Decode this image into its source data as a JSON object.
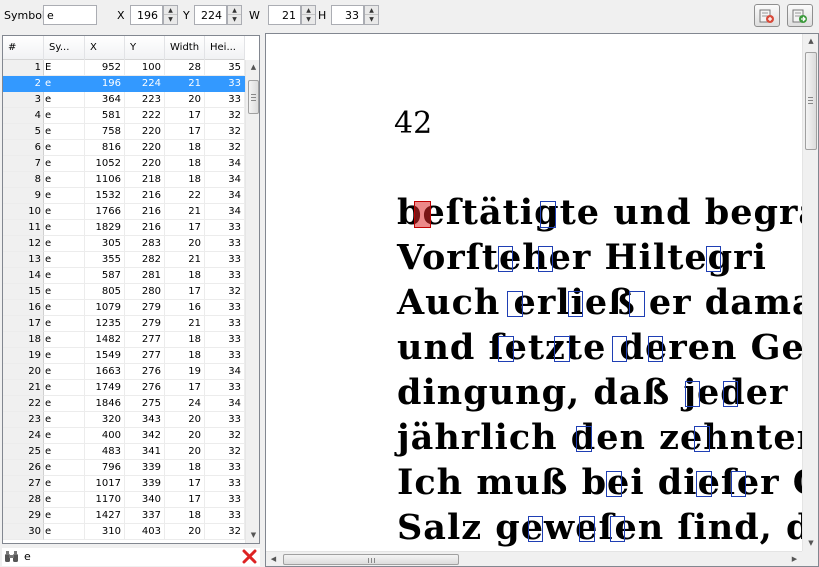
{
  "toolbar": {
    "symbol_label": "Symbol",
    "symbol_value": "e",
    "x_label": "X",
    "x_value": "196",
    "y_label": "Y",
    "y_value": "224",
    "w_label": "W",
    "w_value": "21",
    "h_label": "H",
    "h_value": "33",
    "buttons": [
      {
        "name": "import-boxes-button",
        "icon": "import-icon"
      },
      {
        "name": "export-boxes-button",
        "icon": "export-icon"
      }
    ]
  },
  "table": {
    "columns": [
      "#",
      "Sy...",
      "X",
      "Y",
      "Width",
      "Hei..."
    ],
    "selected_row": 2,
    "rows": [
      [
        "1",
        "E",
        "952",
        "100",
        "28",
        "35"
      ],
      [
        "2",
        "e",
        "196",
        "224",
        "21",
        "33"
      ],
      [
        "3",
        "e",
        "364",
        "223",
        "20",
        "33"
      ],
      [
        "4",
        "e",
        "581",
        "222",
        "17",
        "32"
      ],
      [
        "5",
        "e",
        "758",
        "220",
        "17",
        "32"
      ],
      [
        "6",
        "e",
        "816",
        "220",
        "18",
        "32"
      ],
      [
        "7",
        "e",
        "1052",
        "220",
        "18",
        "34"
      ],
      [
        "8",
        "e",
        "1106",
        "218",
        "18",
        "34"
      ],
      [
        "9",
        "e",
        "1532",
        "216",
        "22",
        "34"
      ],
      [
        "10",
        "e",
        "1766",
        "216",
        "21",
        "34"
      ],
      [
        "11",
        "e",
        "1829",
        "216",
        "17",
        "33"
      ],
      [
        "12",
        "e",
        "305",
        "283",
        "20",
        "33"
      ],
      [
        "13",
        "e",
        "355",
        "282",
        "21",
        "33"
      ],
      [
        "14",
        "e",
        "587",
        "281",
        "18",
        "33"
      ],
      [
        "15",
        "e",
        "805",
        "280",
        "17",
        "32"
      ],
      [
        "16",
        "e",
        "1079",
        "279",
        "16",
        "33"
      ],
      [
        "17",
        "e",
        "1235",
        "279",
        "21",
        "33"
      ],
      [
        "18",
        "e",
        "1482",
        "277",
        "18",
        "33"
      ],
      [
        "19",
        "e",
        "1549",
        "277",
        "18",
        "33"
      ],
      [
        "20",
        "e",
        "1663",
        "276",
        "19",
        "34"
      ],
      [
        "21",
        "e",
        "1749",
        "276",
        "17",
        "33"
      ],
      [
        "22",
        "e",
        "1846",
        "275",
        "24",
        "34"
      ],
      [
        "23",
        "e",
        "320",
        "343",
        "20",
        "33"
      ],
      [
        "24",
        "e",
        "400",
        "342",
        "20",
        "32"
      ],
      [
        "25",
        "e",
        "483",
        "341",
        "20",
        "32"
      ],
      [
        "26",
        "e",
        "796",
        "339",
        "18",
        "33"
      ],
      [
        "27",
        "e",
        "1017",
        "339",
        "17",
        "33"
      ],
      [
        "28",
        "e",
        "1170",
        "340",
        "17",
        "33"
      ],
      [
        "29",
        "e",
        "1427",
        "337",
        "18",
        "33"
      ],
      [
        "30",
        "e",
        "310",
        "403",
        "20",
        "32"
      ]
    ]
  },
  "filter": {
    "value": "e",
    "search_icon": "binoculars-icon",
    "clear_icon": "red-x-icon"
  },
  "image": {
    "page_number": "42",
    "lines": [
      "beſtätigte und begrän",
      "Vorſteher Hiltegri",
      "Auch erließ er damal",
      "und ſetzte deren Geſa",
      "dingung, daß jeder S",
      "jährlich den zehnten",
      "Ich muß bei dieſer G",
      "Salz geweſen ſind, d"
    ]
  }
}
